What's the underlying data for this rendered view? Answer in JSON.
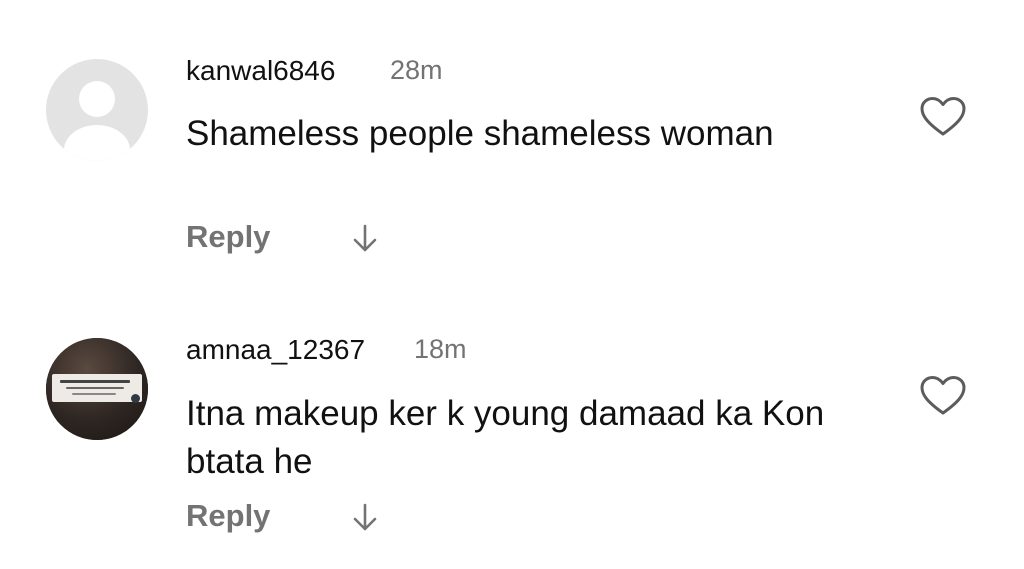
{
  "comments": [
    {
      "username": "kanwal6846",
      "time": "28m",
      "text": "Shameless people shameless woman",
      "reply_label": "Reply",
      "avatar": "default-avatar",
      "like_icon": "heart-outline-icon",
      "expand_icon": "arrow-down-icon"
    },
    {
      "username": "amnaa_12367",
      "time": "18m",
      "text": "Itna makeup ker k young damaad ka Kon btata he",
      "reply_label": "Reply",
      "avatar": "photo-avatar",
      "like_icon": "heart-outline-icon",
      "expand_icon": "arrow-down-icon"
    }
  ],
  "colors": {
    "text_primary": "#111111",
    "text_secondary": "#737373",
    "background": "#ffffff",
    "avatar_placeholder": "#e3e3e3"
  }
}
